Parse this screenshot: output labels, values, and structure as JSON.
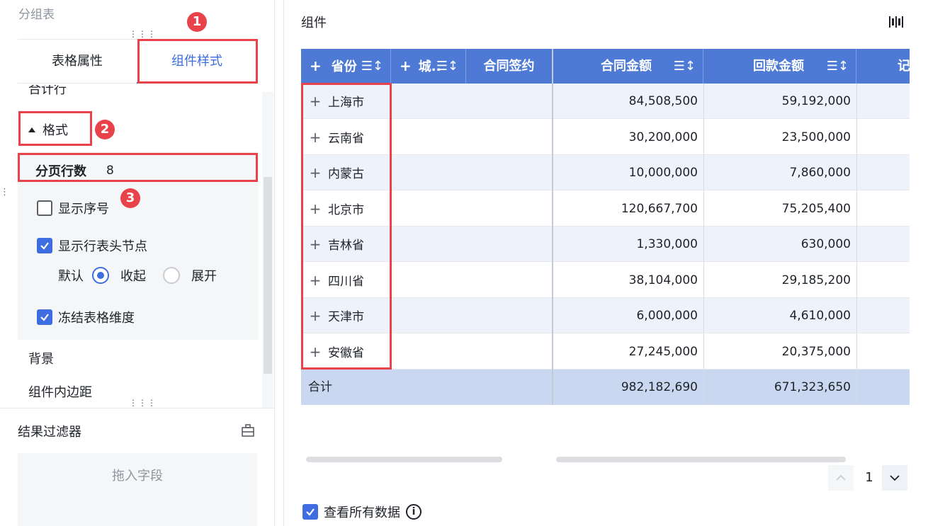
{
  "left_panel": {
    "group_title": "分组表",
    "tabs": [
      {
        "label": "表格属性",
        "active": false
      },
      {
        "label": "组件样式",
        "active": true
      }
    ],
    "sections": {
      "subtotal_label": "合计行",
      "format_label": "格式",
      "page_rows_label": "分页行数",
      "page_rows_value": "8",
      "show_index_label": "显示序号",
      "show_index_checked": false,
      "show_row_header_label": "显示行表头节点",
      "show_row_header_checked": true,
      "default_label": "默认",
      "radio_collapse_label": "收起",
      "radio_expand_label": "展开",
      "radio_selected": "收起",
      "freeze_label": "冻结表格维度",
      "freeze_checked": true,
      "background_label": "背景",
      "padding_label": "组件内边距"
    },
    "filter": {
      "title": "结果过滤器",
      "drop_placeholder": "拖入字段"
    },
    "annotations": [
      "1",
      "2",
      "3"
    ]
  },
  "right_panel": {
    "title": "组件",
    "table": {
      "headers": [
        {
          "label": "省份",
          "has_plus": true,
          "sort": true
        },
        {
          "label": "城..",
          "has_plus": true,
          "sort": true
        },
        {
          "label": "合同签约",
          "has_plus": false,
          "sort": false
        },
        {
          "label": "合同金额",
          "has_plus": false,
          "sort": true
        },
        {
          "label": "回款金额",
          "has_plus": false,
          "sort": true
        },
        {
          "label": "记",
          "has_plus": false,
          "sort": false
        }
      ],
      "rows": [
        {
          "province": "上海市",
          "contract_amount": "84,508,500",
          "payment_amount": "59,192,000"
        },
        {
          "province": "云南省",
          "contract_amount": "30,200,000",
          "payment_amount": "23,500,000"
        },
        {
          "province": "内蒙古",
          "contract_amount": "10,000,000",
          "payment_amount": "7,860,000"
        },
        {
          "province": "北京市",
          "contract_amount": "120,667,700",
          "payment_amount": "75,205,400"
        },
        {
          "province": "吉林省",
          "contract_amount": "1,330,000",
          "payment_amount": "630,000"
        },
        {
          "province": "四川省",
          "contract_amount": "38,104,000",
          "payment_amount": "29,185,200"
        },
        {
          "province": "天津市",
          "contract_amount": "6,000,000",
          "payment_amount": "4,610,000"
        },
        {
          "province": "安徽省",
          "contract_amount": "27,245,000",
          "payment_amount": "20,375,000"
        }
      ],
      "total": {
        "label": "合计",
        "contract_amount": "982,182,690",
        "payment_amount": "671,323,650"
      }
    },
    "pager": {
      "current_page": "1"
    },
    "show_all_data": {
      "label": "查看所有数据",
      "checked": true,
      "info_glyph": "i"
    }
  },
  "colors": {
    "accent": "#3d6de0",
    "header_bg": "#4e7ad6",
    "annotation_red": "#e8434a",
    "total_bg": "#c9d7f1"
  }
}
